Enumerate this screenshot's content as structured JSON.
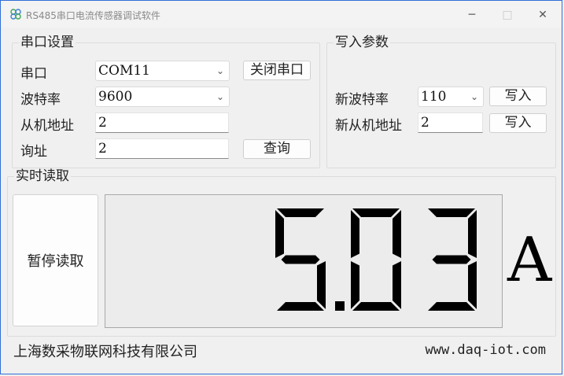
{
  "window": {
    "title": "RS485串口电流传感器调试软件",
    "minimize_glyph": "─",
    "maximize_glyph": "□",
    "close_glyph": "✕"
  },
  "serial": {
    "legend": "串口设置",
    "port_label": "串口",
    "port_value": "COM11",
    "close_port_button": "关闭串口",
    "baud_label": "波特率",
    "baud_value": "9600",
    "slave_label": "从机地址",
    "slave_value": "2",
    "query_label": "询址",
    "query_value": "2",
    "query_button": "查询"
  },
  "write": {
    "legend": "写入参数",
    "new_baud_label": "新波特率",
    "new_baud_value": "110",
    "write_button_1": "写入",
    "new_slave_label": "新从机地址",
    "new_slave_value": "2",
    "write_button_2": "写入"
  },
  "realtime": {
    "legend": "实时读取",
    "pause_button": "暂停读取",
    "reading": "5.03",
    "unit": "A"
  },
  "footer": {
    "company": "上海数采物联网科技有限公司",
    "website": "www.daq-iot.com"
  },
  "colors": {
    "window_border": "#2f6fd6",
    "segment": "#000000",
    "display_bg": "#ececec"
  }
}
